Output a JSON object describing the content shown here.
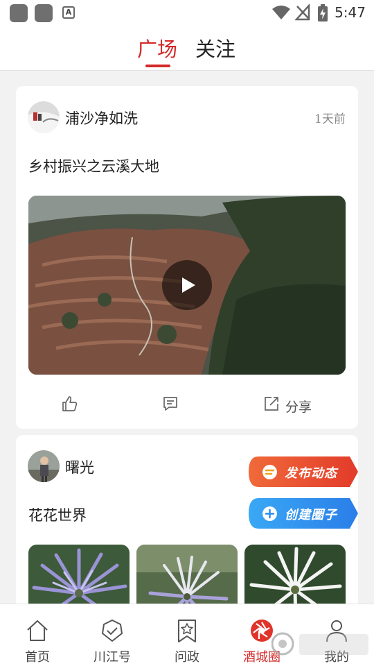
{
  "status_bar": {
    "time": "5:47",
    "notification_letter": "A"
  },
  "header": {
    "tabs": [
      {
        "label": "广场",
        "active": true
      },
      {
        "label": "关注",
        "active": false
      }
    ]
  },
  "posts": [
    {
      "author": "浦沙净如洗",
      "time_ago": "1天前",
      "title": "乡村振兴之云溪大地",
      "media": "video",
      "actions": {
        "share_label": "分享"
      }
    },
    {
      "author": "曙光",
      "title": "花花世界",
      "media": "images"
    }
  ],
  "floating_actions": {
    "publish_label": "发布动态",
    "create_label": "创建圈子"
  },
  "bottom_nav": [
    {
      "label": "首页",
      "icon": "home-icon",
      "active": false
    },
    {
      "label": "川江号",
      "icon": "badge-check-icon",
      "active": false
    },
    {
      "label": "问政",
      "icon": "bookmark-star-icon",
      "active": false
    },
    {
      "label": "酒城圈",
      "icon": "aperture-icon",
      "active": true
    },
    {
      "label": "我的",
      "icon": "user-icon",
      "active": false
    }
  ],
  "colors": {
    "accent": "#d42a2a",
    "publish_button": "#e8452c",
    "create_button": "#2a8ef0"
  }
}
